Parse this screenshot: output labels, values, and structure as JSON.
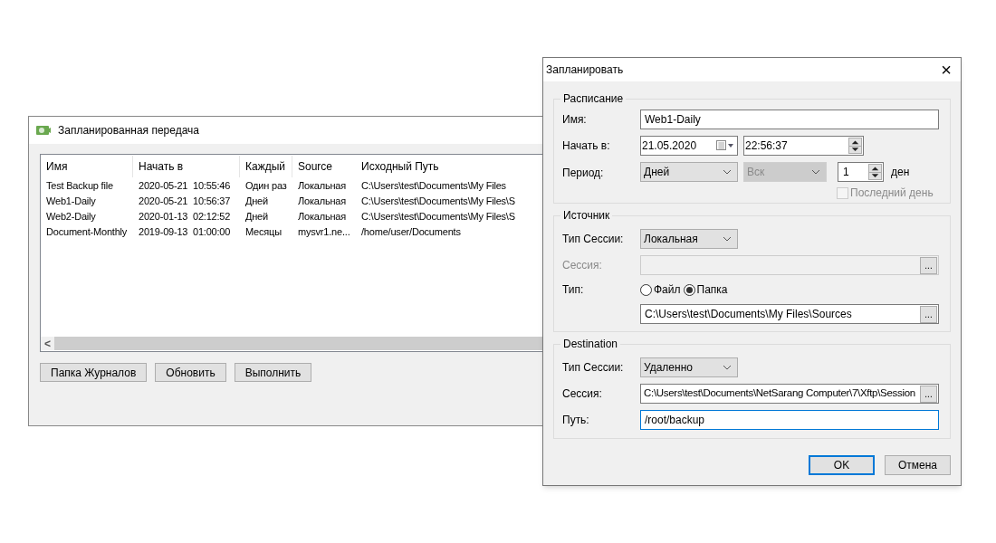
{
  "main_window": {
    "title": "Запланированная передача",
    "table": {
      "columns": [
        "Имя",
        "Начать в",
        "Каждый",
        "Source",
        "Исходный Путь"
      ],
      "rows": [
        {
          "cells": [
            "Test Backup file",
            "2020-05-21  10:55:46",
            "Один раз",
            "Локальная",
            "C:\\Users\\test\\Documents\\My Files"
          ]
        },
        {
          "cells": [
            "Web1-Daily",
            "2020-05-21  10:56:37",
            "Дней",
            "Локальная",
            "C:\\Users\\test\\Documents\\My Files\\S"
          ]
        },
        {
          "cells": [
            "Web2-Daily",
            "2020-01-13  02:12:52",
            "Дней",
            "Локальная",
            "C:\\Users\\test\\Documents\\My Files\\S"
          ]
        },
        {
          "cells": [
            "Document-Monthly",
            "2019-09-13  01:00:00",
            "Месяцы",
            "mysvr1.ne...",
            "/home/user/Documents"
          ]
        }
      ]
    },
    "scroll_left": "<",
    "buttons": [
      "Папка Журналов",
      "Обновить",
      "Выполнить"
    ]
  },
  "dialog": {
    "title": "Запланировать",
    "close": "×",
    "schedule": {
      "title": "Расписание",
      "name_label": "Имя:",
      "name": "Web1-Daily",
      "start_label": "Начать в:",
      "date": "21.05.2020",
      "time": "22:56:37",
      "period_label": "Период:",
      "period": "Дней",
      "weekday": {
        "value": "Вск",
        "disabled": true
      },
      "count": "1",
      "unit": "ден",
      "last_day": {
        "label": "Последний день",
        "checked": false,
        "disabled": true
      }
    },
    "source": {
      "title": "Источник",
      "session_type_label": "Тип Сессии:",
      "session_type": "Локальная",
      "session_label": "Сессия:",
      "session": {
        "disabled": true
      },
      "browse": "...",
      "type_label": "Тип:",
      "types": [
        {
          "label": "Файл",
          "selected": false
        },
        {
          "label": "Папка",
          "selected": true
        }
      ],
      "path": "C:\\Users\\test\\Documents\\My Files\\Sources",
      "path_browse": "..."
    },
    "destination": {
      "title": "Destination",
      "session_type_label": "Тип Сессии:",
      "session_type": "Удаленно",
      "session_label": "Сессия:",
      "session": "C:\\Users\\test\\Documents\\NetSarang Computer\\7\\Xftp\\Session",
      "browse": "...",
      "path_label": "Путь:",
      "path": "/root/backup"
    },
    "buttons": [
      {
        "label": "OK",
        "default": true
      },
      {
        "label": "Отмена",
        "default": false
      }
    ]
  }
}
